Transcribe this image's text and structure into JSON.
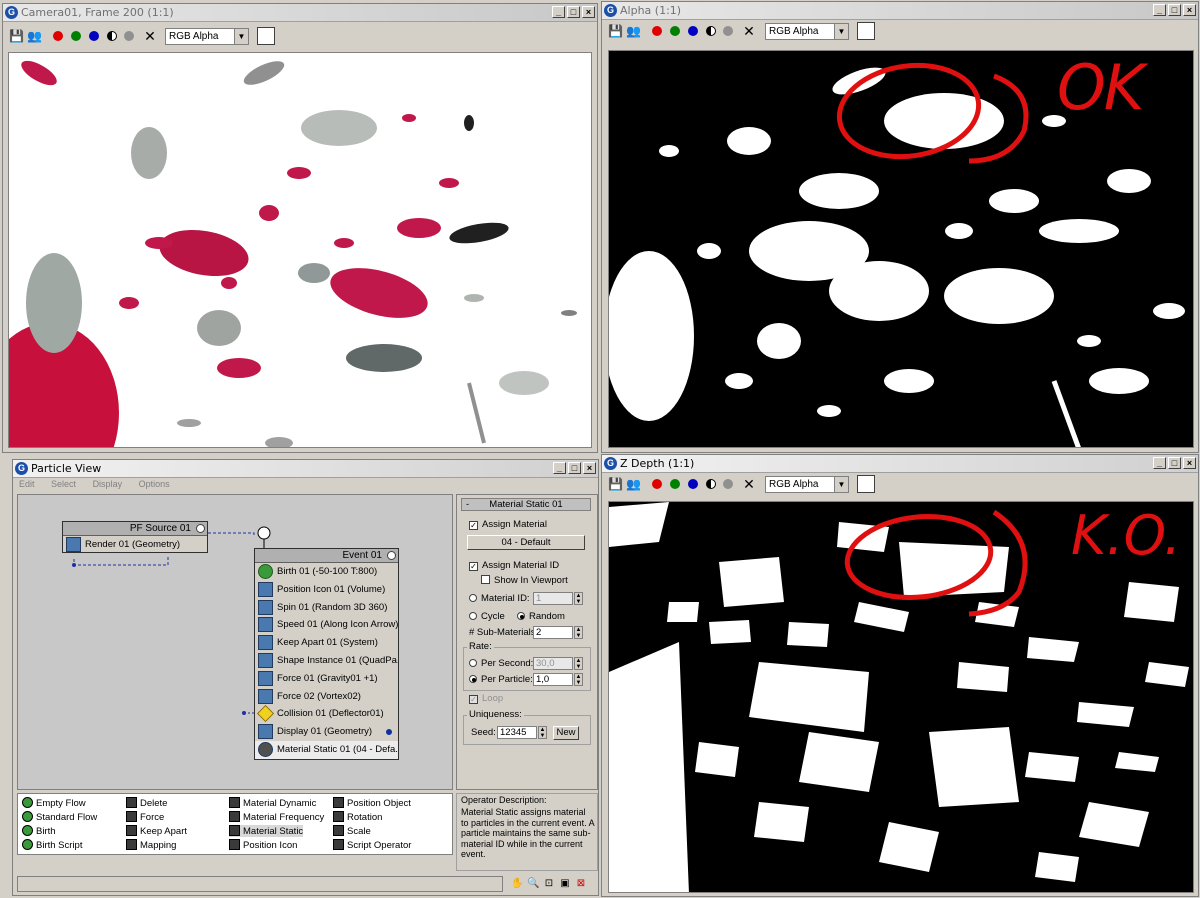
{
  "windows": {
    "camera": {
      "title": "Camera01, Frame 200 (1:1)",
      "channel": "RGB Alpha"
    },
    "alpha": {
      "title": "Alpha (1:1)",
      "channel": "RGB Alpha",
      "annotation": "OK"
    },
    "zdepth": {
      "title": "Z Depth (1:1)",
      "channel": "RGB Alpha",
      "annotation": "K.O."
    },
    "particle_view": {
      "title": "Particle View",
      "menu": [
        "Edit",
        "Select",
        "Display",
        "Options"
      ],
      "pf_source": {
        "title": "PF Source 01",
        "ops": [
          "Render 01 (Geometry)"
        ]
      },
      "event": {
        "title": "Event 01",
        "ops": [
          "Birth 01 (-50-100 T:800)",
          "Position Icon 01 (Volume)",
          "Spin 01 (Random 3D 360)",
          "Speed 01 (Along Icon Arrow)",
          "Keep Apart 01 (System)",
          "Shape Instance 01 (QuadPa...",
          "Force 01 (Gravity01 +1)",
          "Force 02 (Vortex02)",
          "Collision 01 (Deflector01)",
          "Display 01 (Geometry)",
          "Material Static 01 (04 - Defa..."
        ]
      },
      "params": {
        "rollout_title": "Material Static 01",
        "rollout_sign": "-",
        "assign_material": "Assign Material",
        "material_button": "04 - Default",
        "assign_material_id": "Assign Material ID",
        "show_in_viewport": "Show In Viewport",
        "material_id_label": "Material ID:",
        "material_id_value": "1",
        "cycle": "Cycle",
        "random": "Random",
        "sub_materials_label": "# Sub-Materials:",
        "sub_materials_value": "2",
        "rate_label": "Rate:",
        "per_second": "Per Second:",
        "per_second_value": "30,0",
        "per_particle": "Per Particle:",
        "per_particle_value": "1,0",
        "loop": "Loop",
        "uniqueness_label": "Uniqueness:",
        "seed_label": "Seed:",
        "seed_value": "12345",
        "new_button": "New"
      },
      "depot": [
        [
          "Empty Flow",
          "Standard Flow",
          "Birth",
          "Birth Script"
        ],
        [
          "Delete",
          "Force",
          "Keep Apart",
          "Mapping"
        ],
        [
          "Material Dynamic",
          "Material Frequency",
          "Material Static",
          "Position Icon"
        ],
        [
          "Position Object",
          "Rotation",
          "Scale",
          "Script Operator"
        ]
      ],
      "description": {
        "label": "Operator Description:",
        "text": "Material Static assigns material to particles in the current event.  A particle maintains the same sub-material ID while in the current event."
      }
    }
  },
  "colors": {
    "annotation": "#e01010",
    "petal": "#c0184a"
  }
}
